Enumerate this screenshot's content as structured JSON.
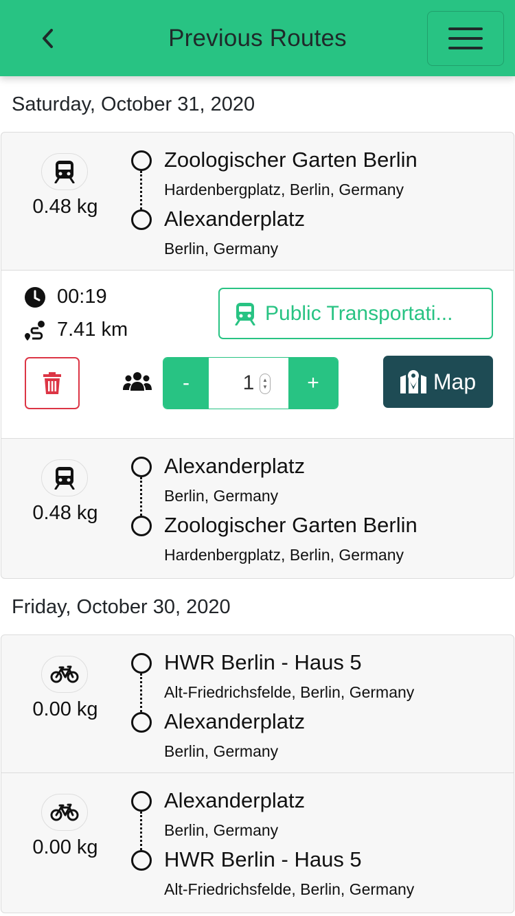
{
  "header": {
    "title": "Previous Routes",
    "back_icon": "chevron-left-icon",
    "menu_icon": "hamburger-menu-icon",
    "bg_color": "#28c383"
  },
  "days": [
    {
      "date": "Saturday, October 31, 2020",
      "routes": [
        {
          "mode_icon": "train-icon",
          "emission": "0.48 kg",
          "from_name": "Zoologischer Garten Berlin",
          "from_addr": "Hardenbergplatz, Berlin, Germany",
          "to_name": "Alexanderplatz",
          "to_addr": "Berlin, Germany"
        },
        {
          "mode_icon": "train-icon",
          "emission": "0.48 kg",
          "from_name": "Alexanderplatz",
          "from_addr": "Berlin, Germany",
          "to_name": "Zoologischer Garten Berlin",
          "to_addr": "Hardenbergplatz, Berlin, Germany"
        }
      ],
      "detail": {
        "duration": "00:19",
        "distance": "7.41 km",
        "mode_label": "Public Transportati...",
        "passengers": "1",
        "minus_label": "-",
        "plus_label": "+",
        "map_label": "Map"
      }
    },
    {
      "date": "Friday, October 30, 2020",
      "routes": [
        {
          "mode_icon": "bicycle-icon",
          "emission": "0.00 kg",
          "from_name": "HWR Berlin - Haus 5",
          "from_addr": "Alt-Friedrichsfelde, Berlin, Germany",
          "to_name": "Alexanderplatz",
          "to_addr": "Berlin, Germany"
        },
        {
          "mode_icon": "bicycle-icon",
          "emission": "0.00 kg",
          "from_name": "Alexanderplatz",
          "from_addr": "Berlin, Germany",
          "to_name": "HWR Berlin - Haus 5",
          "to_addr": "Alt-Friedrichsfelde, Berlin, Germany"
        }
      ]
    }
  ],
  "colors": {
    "accent": "#28c383",
    "danger": "#dc3545",
    "map_button": "#1e4b54"
  }
}
